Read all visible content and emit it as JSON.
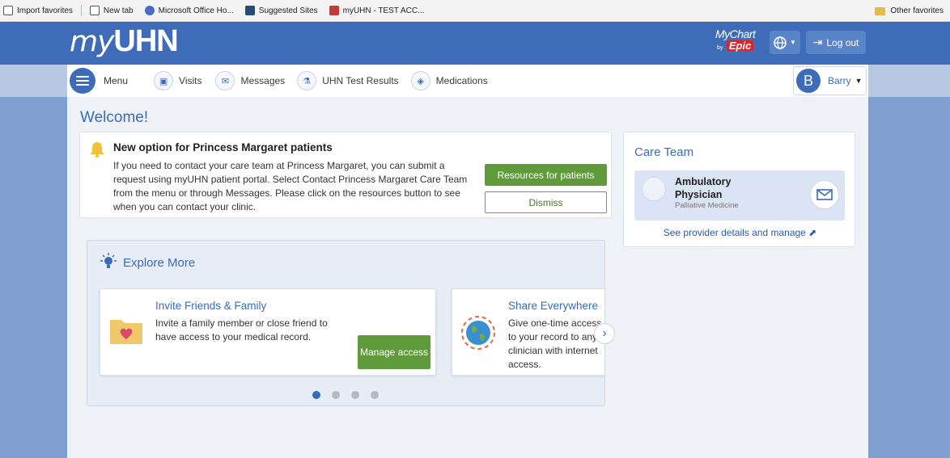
{
  "favorites_bar": {
    "items": [
      {
        "label": "Import favorites",
        "icon": "import-icon"
      },
      {
        "label": "New tab",
        "icon": "tab-icon"
      },
      {
        "label": "Microsoft Office Ho...",
        "icon": "office-icon"
      },
      {
        "label": "Suggested Sites",
        "icon": "bing-icon"
      },
      {
        "label": "myUHN - TEST ACC...",
        "icon": "uhn-icon"
      }
    ],
    "other": "Other favorites"
  },
  "header": {
    "logo_my": "my",
    "logo_uhn": "UHN",
    "mychart": "MyChart",
    "mychart_by": "by",
    "epic": "Epic",
    "logout": "Log out"
  },
  "nav": {
    "menu": "Menu",
    "visits": "Visits",
    "messages": "Messages",
    "test_results": "UHN Test Results",
    "medications": "Medications",
    "user_initial": "B",
    "user_name": "Barry"
  },
  "welcome": "Welcome!",
  "alert": {
    "title": "New option for Princess Margaret patients",
    "body": "If you need to contact your care team at Princess Margaret, you can submit a request using myUHN patient portal. Select Contact Princess Margaret Care Team from the menu or through Messages. Please click on the resources button to see when you can contact your clinic.",
    "resources_btn": "Resources for patients",
    "dismiss_btn": "Dismiss"
  },
  "care_team": {
    "title": "Care Team",
    "provider_name": "Ambulatory Physician",
    "provider_specialty": "Palliative Medicine",
    "link": "See provider details and manage"
  },
  "explore": {
    "title": "Explore More",
    "cards": [
      {
        "title": "Invite Friends & Family",
        "text": "Invite a family member or close friend to have access to your medical record.",
        "button": "Manage access"
      },
      {
        "title": "Share Everywhere",
        "text": "Give one-time access to your record to any clinician with internet access."
      }
    ],
    "page_count": 4,
    "active_page": 1
  },
  "colors": {
    "brand_blue": "#3f6cb8",
    "action_green": "#5f9b3b",
    "epic_red": "#d9262e"
  }
}
